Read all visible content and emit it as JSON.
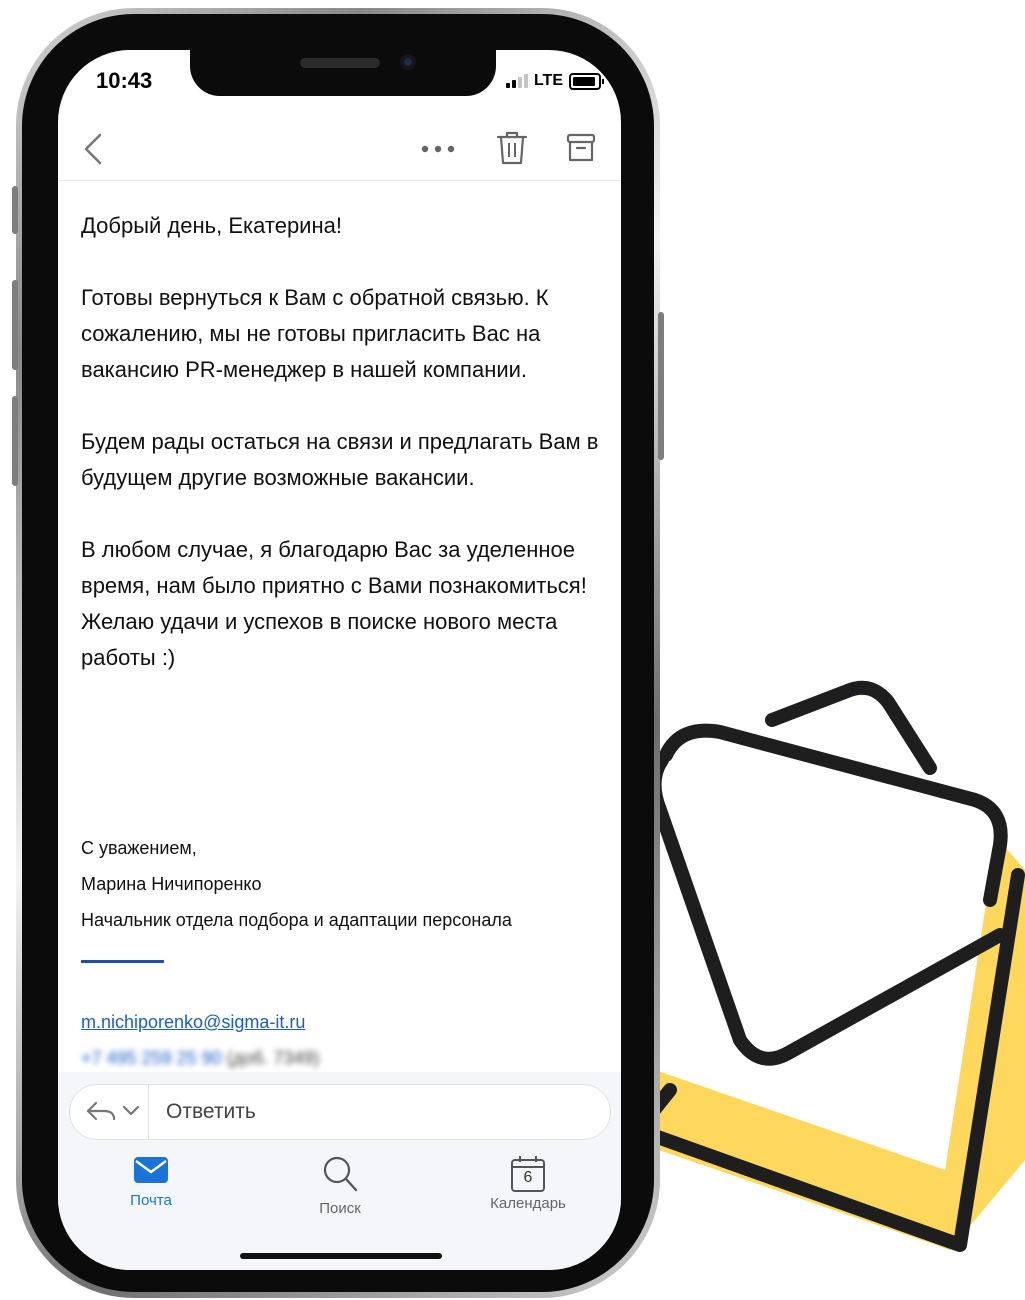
{
  "status_bar": {
    "time": "10:43",
    "network": "LTE"
  },
  "toolbar": {
    "icons": [
      "back-icon",
      "more-icon",
      "trash-icon",
      "archive-icon"
    ]
  },
  "email": {
    "greeting": "Добрый день, Екатерина!",
    "paragraph_1": "Готовы вернуться к Вам с обратной связью. К сожалению, мы не готовы пригласить Вас на вакансию PR-менеджер в нашей компании.",
    "paragraph_2": "Будем рады остаться на связи и предлагать Вам в будущем другие возможные вакансии.",
    "paragraph_3": "В любом случае, я благодарю Вас за уделенное время, нам было приятно с Вами познакомиться! Желаю удачи и успехов в поиске нового места работы :)",
    "signature": {
      "closing": "С уважением,",
      "name": "Марина Ничипоренко",
      "position": "Начальник отдела подбора и адаптации персонала",
      "email": "m.nichiporenko@sigma-it.ru",
      "phone": "+7 495 259 25 90",
      "extension": "(доб. 7349)"
    }
  },
  "reply": {
    "label": "Ответить"
  },
  "tabs": [
    {
      "label": "Почта",
      "icon": "mail-icon",
      "active": true
    },
    {
      "label": "Поиск",
      "icon": "search-icon",
      "active": false
    },
    {
      "label": "Календарь",
      "icon": "calendar-icon",
      "badge": "6",
      "active": false
    }
  ],
  "colors": {
    "accent": "#1a73d9",
    "envelope_yellow": "#fdd85d",
    "link": "#1a5fc9"
  }
}
